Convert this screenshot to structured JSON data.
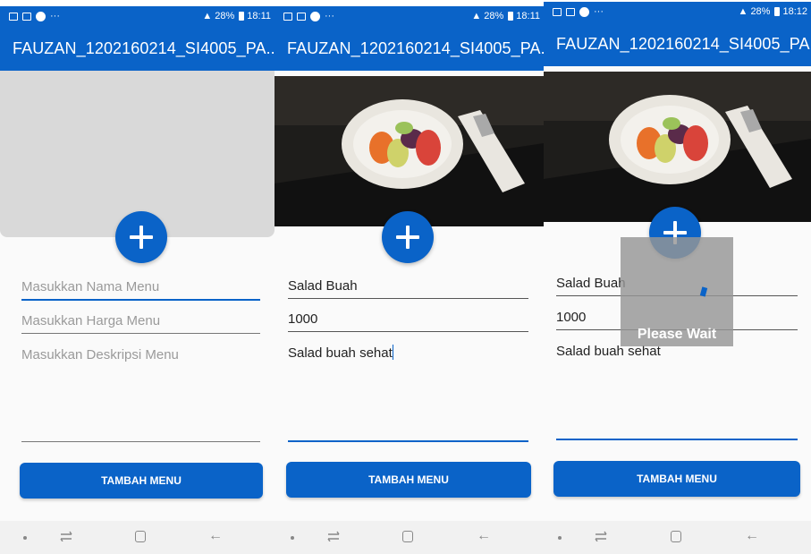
{
  "screens": [
    {
      "status": {
        "time": "18:11",
        "battery": "28%",
        "dots": "···"
      },
      "title": "FAUZAN_1202160214_SI4005_PA...",
      "fields": [
        {
          "value": "",
          "placeholder": "Masukkan Nama Menu"
        },
        {
          "value": "",
          "placeholder": "Masukkan Harga Menu"
        },
        {
          "value": "",
          "placeholder": "Masukkan Deskripsi Menu"
        }
      ],
      "button": "TAMBAH MENU"
    },
    {
      "status": {
        "time": "18:11",
        "battery": "28%",
        "dots": "···"
      },
      "title": "FAUZAN_1202160214_SI4005_PA...",
      "fields": [
        {
          "value": "Salad Buah"
        },
        {
          "value": "1000"
        },
        {
          "value": "Salad buah sehat"
        }
      ],
      "button": "TAMBAH MENU"
    },
    {
      "status": {
        "time": "18:12",
        "battery": "28%",
        "dots": "···"
      },
      "title": "FAUZAN_1202160214_SI4005_PA...",
      "fields": [
        {
          "value": "Salad Buah"
        },
        {
          "value": "1000"
        },
        {
          "value": "Salad buah sehat"
        }
      ],
      "button": "TAMBAH MENU",
      "loading_text": "Please Wait"
    }
  ],
  "nav": {
    "back": "←"
  },
  "colors": {
    "primary": "#0a63c8",
    "image_placeholder": "#d9d9d9"
  },
  "icons": [
    "add-image-icon",
    "battery-icon",
    "back-icon",
    "home-icon",
    "recent-apps-icon"
  ]
}
